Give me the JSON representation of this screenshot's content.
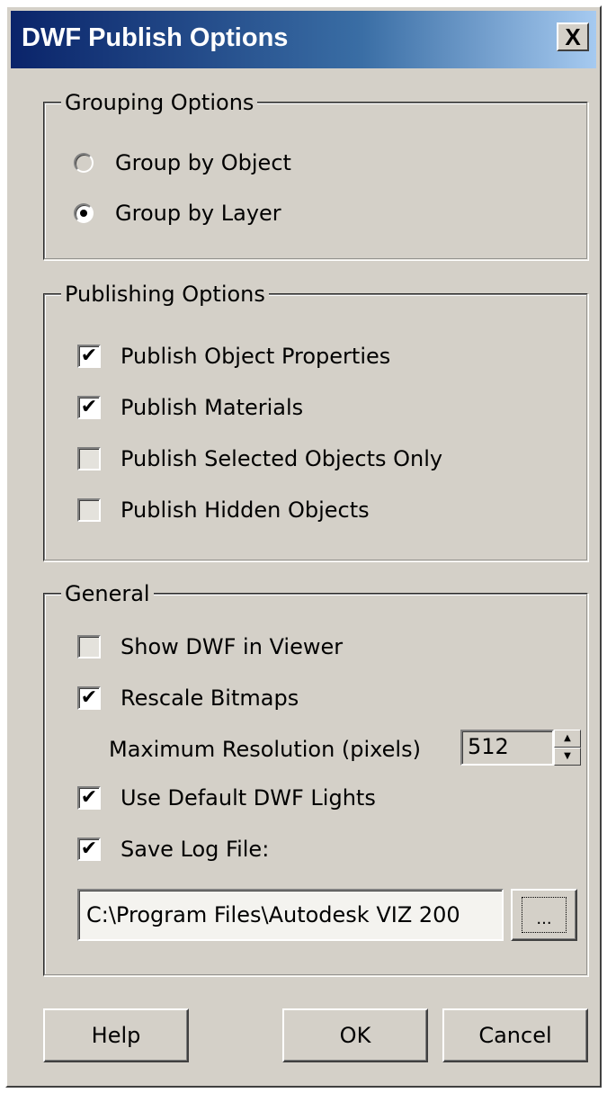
{
  "window": {
    "title": "DWF Publish Options",
    "close_label": "X"
  },
  "grouping": {
    "legend": "Grouping Options",
    "options": [
      {
        "label": "Group by Object",
        "selected": false
      },
      {
        "label": "Group by Layer",
        "selected": true
      }
    ]
  },
  "publishing": {
    "legend": "Publishing Options",
    "items": [
      {
        "label": "Publish Object Properties",
        "checked": true
      },
      {
        "label": "Publish Materials",
        "checked": true
      },
      {
        "label": "Publish Selected Objects Only",
        "checked": false
      },
      {
        "label": "Publish Hidden Objects",
        "checked": false
      }
    ]
  },
  "general": {
    "legend": "General",
    "show_viewer": {
      "label": "Show DWF in Viewer",
      "checked": false
    },
    "rescale": {
      "label": "Rescale Bitmaps",
      "checked": true
    },
    "max_res_label": "Maximum Resolution (pixels)",
    "max_res_value": "512",
    "default_lights": {
      "label": "Use Default DWF Lights",
      "checked": true
    },
    "save_log": {
      "label": "Save Log File:",
      "checked": true
    },
    "log_path": "C:\\Program Files\\Autodesk VIZ 200",
    "browse_label": "..."
  },
  "buttons": {
    "help": "Help",
    "ok": "OK",
    "cancel": "Cancel"
  },
  "glyphs": {
    "check": "✔",
    "spin_up": "▲",
    "spin_down": "▼"
  }
}
